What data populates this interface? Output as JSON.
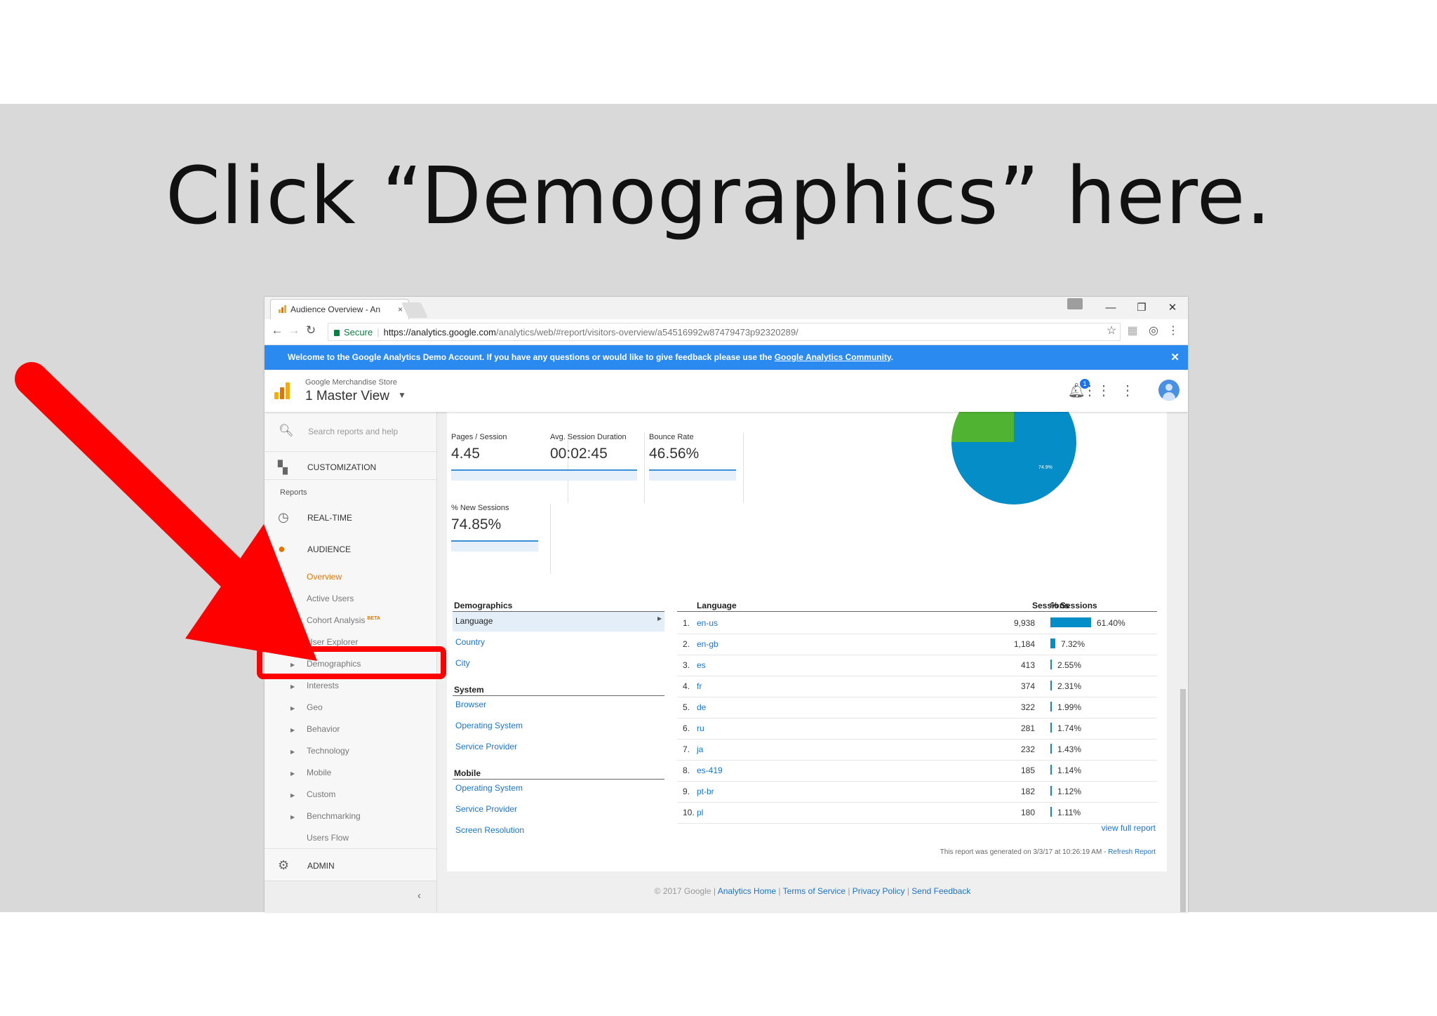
{
  "slide": {
    "instruction": "Click “Demographics” here."
  },
  "browser": {
    "tab_title": "Audience Overview - An",
    "tab_close": "×",
    "window_controls": [
      "—",
      "❐",
      "✕"
    ],
    "secure_label": "Secure",
    "url_scheme_host": "https://analytics.google.com",
    "url_path": "/analytics/web/#report/visitors-overview/a54516992w87479473p92320289/"
  },
  "banner": {
    "text_before": "Welcome to the Google Analytics Demo Account. If you have any questions or would like to give feedback please use the ",
    "link": "Google Analytics Community",
    "text_after": ".",
    "close": "✕"
  },
  "header": {
    "account": "Google Merchandise Store",
    "view": "1 Master View",
    "notification_count": "1"
  },
  "sidebar": {
    "search_placeholder": "Search reports and help",
    "customization": "CUSTOMIZATION",
    "reports_label": "Reports",
    "realtime": "REAL-TIME",
    "audience": "AUDIENCE",
    "audience_items": {
      "overview": "Overview",
      "active_users": "Active Users",
      "cohort": "Cohort Analysis",
      "cohort_badge": "BETA",
      "explorer": "User Explorer",
      "demographics": "Demographics",
      "interests": "Interests",
      "geo": "Geo",
      "behavior": "Behavior",
      "technology": "Technology",
      "mobile": "Mobile",
      "custom": "Custom",
      "benchmarking": "Benchmarking",
      "users_flow": "Users Flow"
    },
    "admin": "ADMIN"
  },
  "metrics": {
    "pages_session": {
      "label": "Pages / Session",
      "value": "4.45"
    },
    "avg_duration": {
      "label": "Avg. Session Duration",
      "value": "00:02:45"
    },
    "bounce_rate": {
      "label": "Bounce Rate",
      "value": "46.56%"
    },
    "new_sessions": {
      "label": "% New Sessions",
      "value": "74.85%"
    }
  },
  "pie": {
    "label": "74.9%",
    "colors": [
      "#058dc7",
      "#50b432"
    ]
  },
  "groups": {
    "demographics": {
      "title": "Demographics",
      "links": [
        "Language",
        "Country",
        "City"
      ]
    },
    "system": {
      "title": "System",
      "links": [
        "Browser",
        "Operating System",
        "Service Provider"
      ]
    },
    "mobile": {
      "title": "Mobile",
      "links": [
        "Operating System",
        "Service Provider",
        "Screen Resolution"
      ]
    }
  },
  "table": {
    "headers": {
      "language": "Language",
      "sessions": "Sessions",
      "pct": "% Sessions"
    },
    "rows": [
      {
        "n": "1.",
        "lang": "en-us",
        "sessions": "9,938",
        "pct": "61.40%",
        "share": 61.4
      },
      {
        "n": "2.",
        "lang": "en-gb",
        "sessions": "1,184",
        "pct": "7.32%",
        "share": 7.32
      },
      {
        "n": "3.",
        "lang": "es",
        "sessions": "413",
        "pct": "2.55%",
        "share": 2.55
      },
      {
        "n": "4.",
        "lang": "fr",
        "sessions": "374",
        "pct": "2.31%",
        "share": 2.31
      },
      {
        "n": "5.",
        "lang": "de",
        "sessions": "322",
        "pct": "1.99%",
        "share": 1.99
      },
      {
        "n": "6.",
        "lang": "ru",
        "sessions": "281",
        "pct": "1.74%",
        "share": 1.74
      },
      {
        "n": "7.",
        "lang": "ja",
        "sessions": "232",
        "pct": "1.43%",
        "share": 1.43
      },
      {
        "n": "8.",
        "lang": "es-419",
        "sessions": "185",
        "pct": "1.14%",
        "share": 1.14
      },
      {
        "n": "9.",
        "lang": "pt-br",
        "sessions": "182",
        "pct": "1.12%",
        "share": 1.12
      },
      {
        "n": "10.",
        "lang": "pl",
        "sessions": "180",
        "pct": "1.11%",
        "share": 1.11
      }
    ],
    "view_full": "view full report",
    "generated": "This report was generated on 3/3/17 at 10:26:19 AM - ",
    "refresh": "Refresh Report"
  },
  "footer": {
    "copyright": "© 2017 Google",
    "links": [
      "Analytics Home",
      "Terms of Service",
      "Privacy Policy",
      "Send Feedback"
    ]
  },
  "colors": {
    "accent": "#2b8af0",
    "highlight": "#ff0000",
    "bar": "#058dc7",
    "active_nav": "#e37400"
  }
}
